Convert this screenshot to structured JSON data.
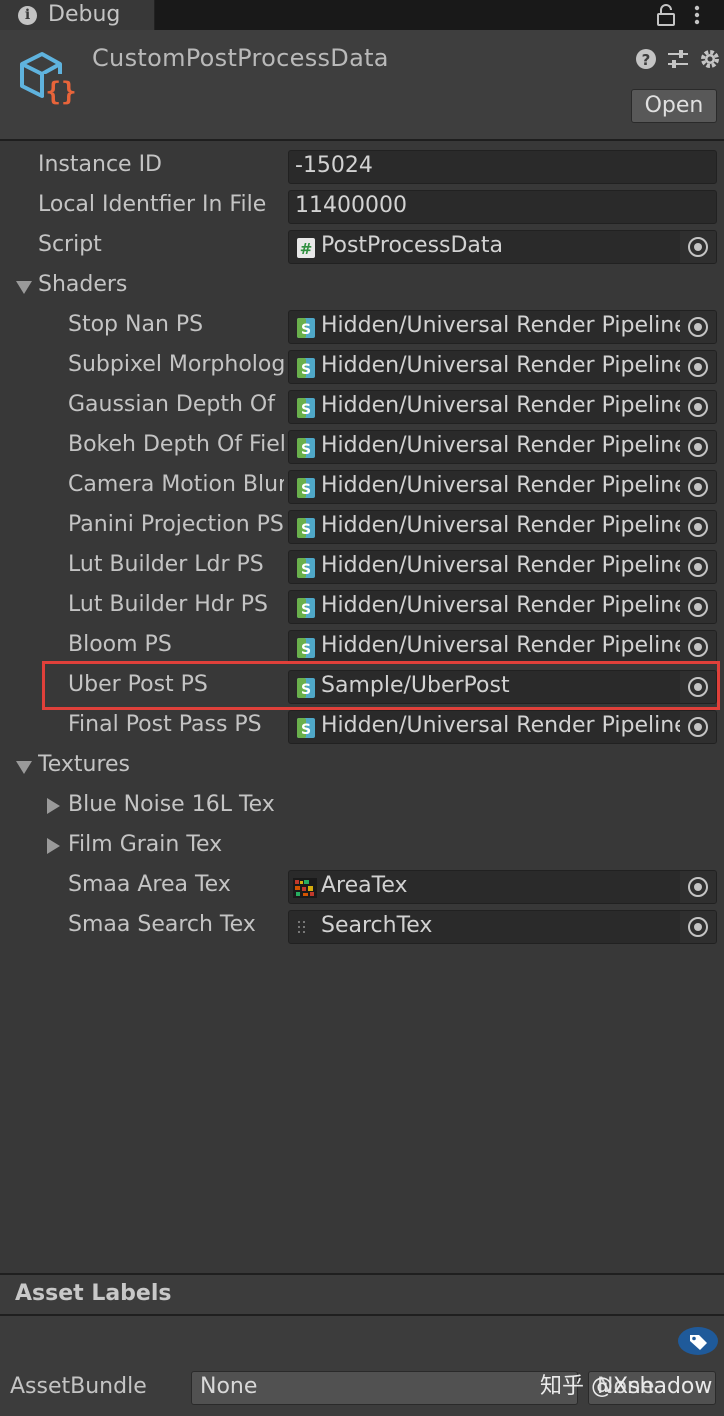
{
  "tab": {
    "label": "Debug",
    "info_glyph": "i"
  },
  "header": {
    "title": "CustomPostProcessData",
    "open_label": "Open"
  },
  "fields": {
    "instance_id": {
      "label": "Instance ID",
      "value": "-15024"
    },
    "local_identifier": {
      "label": "Local Identfier In File",
      "value": "11400000"
    },
    "script": {
      "label": "Script",
      "value": "PostProcessData"
    }
  },
  "shaders": {
    "label": "Shaders",
    "items": [
      {
        "label": "Stop Nan PS",
        "value": "Hidden/Universal Render Pipeline/Stop NaN"
      },
      {
        "label": "Subpixel Morphological Antialiasing PS",
        "value": "Hidden/Universal Render Pipeline/Subpixel Morphological Antialiasing"
      },
      {
        "label": "Gaussian Depth Of Field PS",
        "value": "Hidden/Universal Render Pipeline/Gaussian Depth Of Field"
      },
      {
        "label": "Bokeh Depth Of Field PS",
        "value": "Hidden/Universal Render Pipeline/Bokeh Depth Of Field"
      },
      {
        "label": "Camera Motion Blur PS",
        "value": "Hidden/Universal Render Pipeline/Camera Motion Blur"
      },
      {
        "label": "Panini Projection PS",
        "value": "Hidden/Universal Render Pipeline/Panini Projection"
      },
      {
        "label": "Lut Builder Ldr PS",
        "value": "Hidden/Universal Render Pipeline/LutBuilderLdr"
      },
      {
        "label": "Lut Builder Hdr PS",
        "value": "Hidden/Universal Render Pipeline/LutBuilderHdr"
      },
      {
        "label": "Bloom PS",
        "value": "Hidden/Universal Render Pipeline/Bloom"
      },
      {
        "label": "Uber Post PS",
        "value": "Sample/UberPost"
      },
      {
        "label": "Final Post Pass PS",
        "value": "Hidden/Universal Render Pipeline/FinalPost"
      }
    ]
  },
  "textures": {
    "label": "Textures",
    "blue_noise": {
      "label": "Blue Noise 16L Tex"
    },
    "film_grain": {
      "label": "Film Grain Tex"
    },
    "smaa_area": {
      "label": "Smaa Area Tex",
      "value": "AreaTex"
    },
    "smaa_search": {
      "label": "Smaa Search Tex",
      "value": "SearchTex"
    }
  },
  "asset_labels": {
    "title": "Asset Labels",
    "assetbundle_label": "AssetBundle",
    "bundle_value": "None",
    "variant_value": "None"
  },
  "watermark": "知乎 @Xshadow",
  "colors": {
    "background": "#383838",
    "field": "#2a2a2a",
    "highlight": "#e0403a",
    "asset_icon_blue": "#5fb3de",
    "asset_icon_orange": "#e8643a"
  },
  "icons": {
    "tab": "info-icon",
    "header": [
      "lock-icon",
      "kebab-menu-icon",
      "script-asset-icon",
      "help-icon",
      "preset-icon",
      "gear-icon"
    ],
    "field_types": [
      "csharp-script-icon",
      "shader-icon",
      "texture-icon"
    ],
    "picker": "object-picker-icon",
    "labels": "tag-icon"
  }
}
